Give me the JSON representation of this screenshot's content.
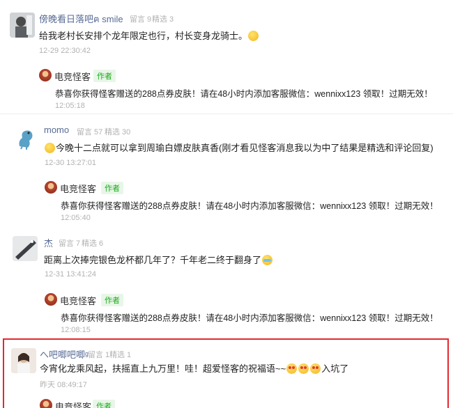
{
  "comments": [
    {
      "nickname": "傍晚看日落吧ฅ smile",
      "likes": "留言 9",
      "featured": "精选 3",
      "text": "给我老村长安排个龙年限定也行，村长变身龙骑士。",
      "emoji": "smirk-emoji",
      "time": "12-29 22:30:42",
      "reply": {
        "name": "电竞怪客",
        "badge": "作者",
        "text": "恭喜你获得怪客赠送的288点券皮肤！请在48小时内添加客服微信：wennixx123 领取！过期无效！",
        "time": "12:05:18"
      }
    },
    {
      "nickname": "momo",
      "likes": "留言 57",
      "featured": "精选 30",
      "text": "今晚十二点就可以拿到周瑜白嫖皮肤真香(刚才看见怪客消息我以为中了结果是精选和评论回复)",
      "emoji": "smile-emoji",
      "time": "12-30 13:27:01",
      "reply": {
        "name": "电竞怪客",
        "badge": "作者",
        "text": "恭喜你获得怪客赠送的288点券皮肤！请在48小时内添加客服微信：wennixx123 领取！过期无效！",
        "time": "12:05:40"
      }
    },
    {
      "nickname": "杰",
      "likes": "留言 7",
      "featured": "精选 6",
      "text": "距离上次捧完银色龙杯都几年了？千年老二终于翻身了",
      "emoji": "crying-emoji",
      "time": "12-31 13:41:24",
      "reply": {
        "name": "电竞怪客",
        "badge": "作者",
        "text": "恭喜你获得怪客赠送的288点券皮肤！请在48小时内添加客服微信：wennixx123 领取！过期无效！",
        "time": "12:08:15"
      }
    },
    {
      "nickname": "へ吧唧吧唧ᵍ",
      "likes": "留言 1",
      "featured": "精选 1",
      "text": "今宵化龙乘风起，扶摇直上九万里！哇！超爱怪客的祝福语~~",
      "text_tail": "入坑了",
      "emoji": "heart-eyes-emoji",
      "time": "昨天 08:49:17",
      "reply": {
        "name": "电竞怪客",
        "badge": "作者"
      }
    }
  ],
  "colors": {
    "nickname": "#576b95",
    "meta": "#b2b2b2",
    "author_badge": "#1aad19",
    "highlight": "#e5272d"
  }
}
